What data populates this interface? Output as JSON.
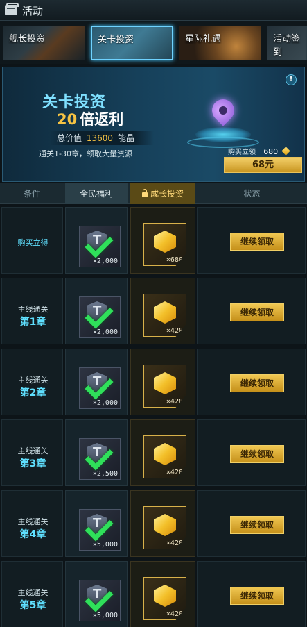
{
  "header": {
    "title": "活动"
  },
  "tabs": [
    {
      "label": "舰长投资",
      "active": false
    },
    {
      "label": "关卡投资",
      "active": true
    },
    {
      "label": "星际礼遇",
      "active": false
    },
    {
      "label": "活动签到",
      "active": false
    }
  ],
  "banner": {
    "title": "关卡投资",
    "subtitle_num": "20",
    "subtitle_text": "倍返利",
    "total_prefix": "总价值",
    "total_value": "13600",
    "total_suffix": "能晶",
    "description": "通关1-30章，领取大量资源",
    "buy_label": "购买立领",
    "buy_amount": "680",
    "price": "68元"
  },
  "columns": {
    "condition": "条件",
    "free": "全民福利",
    "growth": "成长投资",
    "status": "状态"
  },
  "rows": [
    {
      "cond_line1": "购买立得",
      "cond_chapter": "",
      "free_qty": "×2,000",
      "gem_qty": "×680",
      "button": "继续领取"
    },
    {
      "cond_line1": "主线通关",
      "cond_chapter": "第1章",
      "free_qty": "×2,000",
      "gem_qty": "×420",
      "button": "继续领取"
    },
    {
      "cond_line1": "主线通关",
      "cond_chapter": "第2章",
      "free_qty": "×2,000",
      "gem_qty": "×420",
      "button": "继续领取"
    },
    {
      "cond_line1": "主线通关",
      "cond_chapter": "第3章",
      "free_qty": "×2,500",
      "gem_qty": "×420",
      "button": "继续领取"
    },
    {
      "cond_line1": "主线通关",
      "cond_chapter": "第4章",
      "free_qty": "×5,000",
      "gem_qty": "×420",
      "button": "继续领取"
    },
    {
      "cond_line1": "主线通关",
      "cond_chapter": "第5章",
      "free_qty": "×5,000",
      "gem_qty": "×420",
      "button": "继续领取"
    }
  ],
  "colors": {
    "accent_cyan": "#5fe0ff",
    "gold": "#f0c752",
    "check_green": "#2fe05a"
  }
}
